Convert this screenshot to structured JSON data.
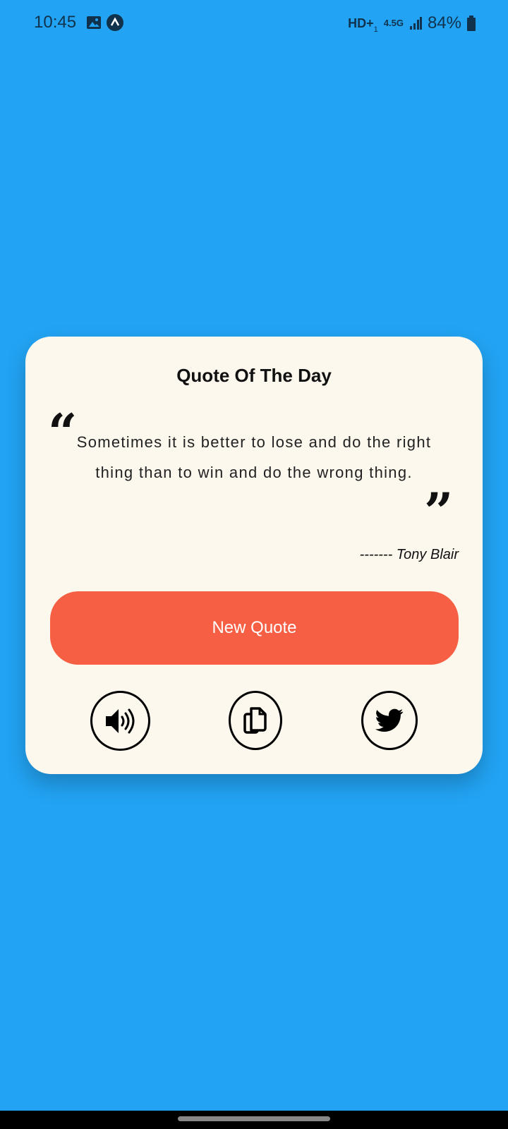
{
  "status_bar": {
    "time": "10:45",
    "network": "HD+",
    "network_sub": "1",
    "data_type": "4.5G",
    "battery": "84%"
  },
  "card": {
    "title": "Quote Of The Day",
    "open_quote": "“",
    "close_quote": "”",
    "quote": "Sometimes it is better to lose and do the right thing than to win and do the wrong thing.",
    "author": "------- Tony Blair",
    "new_quote_label": "New Quote"
  },
  "actions": [
    {
      "icon": "speaker-icon"
    },
    {
      "icon": "copy-icon"
    },
    {
      "icon": "twitter-icon"
    }
  ],
  "colors": {
    "background": "#22a3f3",
    "card": "#fdf8ee",
    "button": "#f65f43"
  }
}
